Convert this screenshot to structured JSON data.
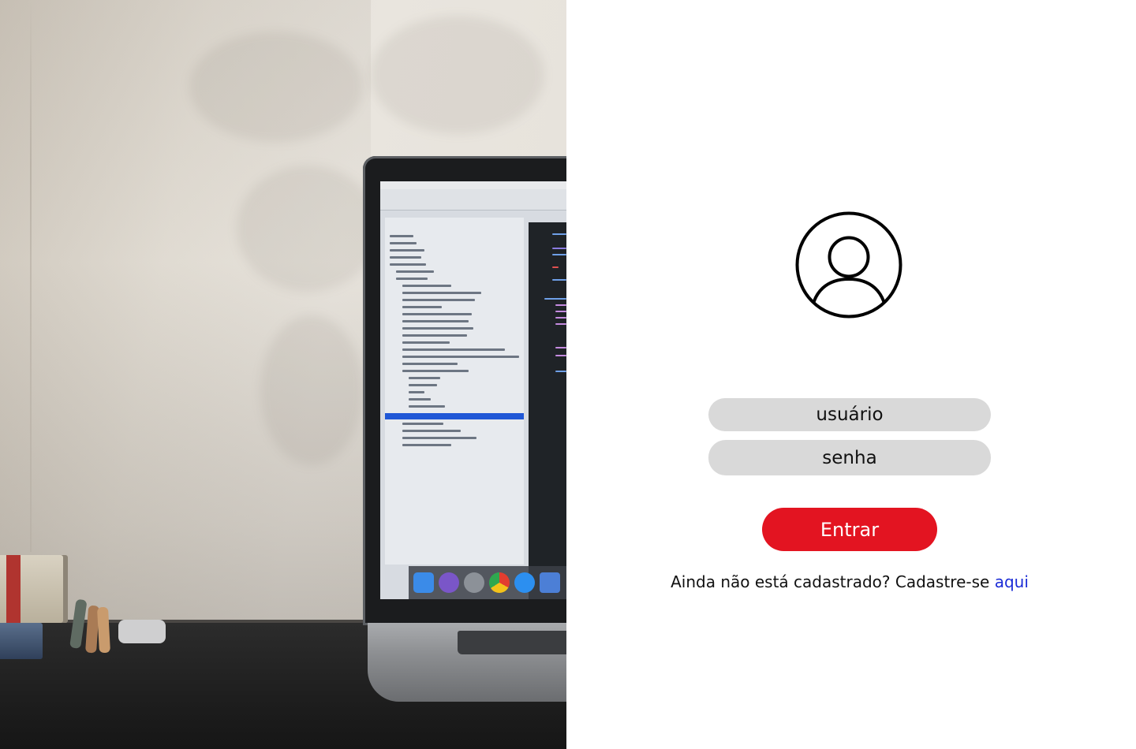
{
  "hero": {
    "image_alt": "laptop"
  },
  "login": {
    "avatar_icon": "user-circle-icon",
    "username_placeholder": "usuário",
    "password_placeholder": "senha",
    "submit_label": "Entrar",
    "signup_prompt": "Ainda não está cadastrado? Cadastre-se",
    "signup_link_label": "aqui"
  },
  "colors": {
    "accent": "#e31421",
    "link": "#1a2bd6",
    "field_bg": "#d9d9d9"
  }
}
